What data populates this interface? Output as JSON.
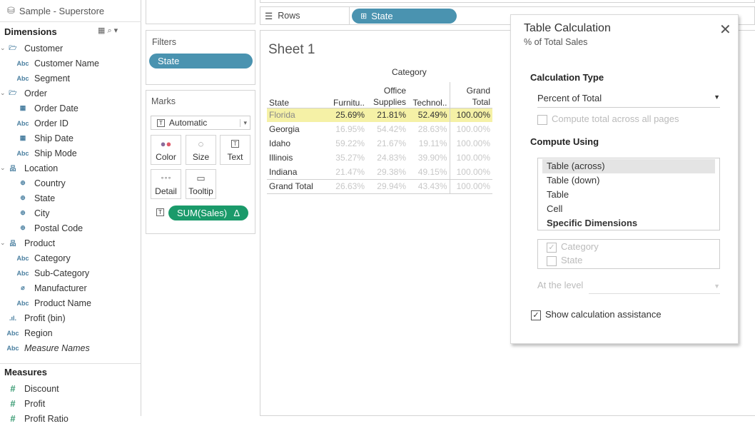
{
  "datasource": "Sample - Superstore",
  "dimensions": {
    "title": "Dimensions",
    "items": [
      {
        "label": "Customer",
        "icon": "folder-icon",
        "level": 0
      },
      {
        "label": "Customer Name",
        "icon": "Abc",
        "level": 1
      },
      {
        "label": "Segment",
        "icon": "Abc",
        "level": 1
      },
      {
        "label": "Order",
        "icon": "folder-icon",
        "level": 0
      },
      {
        "label": "Order Date",
        "icon": "calendar-icon",
        "level": 1
      },
      {
        "label": "Order ID",
        "icon": "Abc",
        "level": 1
      },
      {
        "label": "Ship Date",
        "icon": "calendar-icon",
        "level": 1
      },
      {
        "label": "Ship Mode",
        "icon": "Abc",
        "level": 1
      },
      {
        "label": "Location",
        "icon": "hierarchy-icon",
        "level": 0
      },
      {
        "label": "Country",
        "icon": "globe-icon",
        "level": 1
      },
      {
        "label": "State",
        "icon": "globe-icon",
        "level": 1
      },
      {
        "label": "City",
        "icon": "globe-icon",
        "level": 1
      },
      {
        "label": "Postal Code",
        "icon": "globe-icon",
        "level": 1
      },
      {
        "label": "Product",
        "icon": "hierarchy-icon",
        "level": 0
      },
      {
        "label": "Category",
        "icon": "Abc",
        "level": 1
      },
      {
        "label": "Sub-Category",
        "icon": "Abc",
        "level": 1
      },
      {
        "label": "Manufacturer",
        "icon": "paperclip-icon",
        "level": 1
      },
      {
        "label": "Product Name",
        "icon": "Abc",
        "level": 1
      },
      {
        "label": "Profit (bin)",
        "icon": "bin-icon",
        "level": 0
      },
      {
        "label": "Region",
        "icon": "Abc",
        "level": 0
      },
      {
        "label": "Measure Names",
        "icon": "Abc",
        "level": 0
      }
    ]
  },
  "measures": {
    "title": "Measures",
    "items": [
      "Discount",
      "Profit",
      "Profit Ratio"
    ]
  },
  "filters": {
    "title": "Filters",
    "pill": "State"
  },
  "marks": {
    "title": "Marks",
    "type": "Automatic",
    "buttons": [
      "Color",
      "Size",
      "Text",
      "Detail",
      "Tooltip"
    ],
    "pill": "SUM(Sales)",
    "pill_delta": "Δ"
  },
  "rows": {
    "label": "Rows",
    "pill": "State"
  },
  "sheet": {
    "title": "Sheet 1",
    "col_group": "Category",
    "headers": [
      "State",
      "Furnitu..",
      "Office Supplies",
      "Technol..",
      "Grand Total"
    ],
    "rows": [
      {
        "state": "Florida",
        "v": [
          "25.69%",
          "21.81%",
          "52.49%",
          "100.00%"
        ]
      },
      {
        "state": "Georgia",
        "v": [
          "16.95%",
          "54.42%",
          "28.63%",
          "100.00%"
        ]
      },
      {
        "state": "Idaho",
        "v": [
          "59.22%",
          "21.67%",
          "19.11%",
          "100.00%"
        ]
      },
      {
        "state": "Illinois",
        "v": [
          "35.27%",
          "24.83%",
          "39.90%",
          "100.00%"
        ]
      },
      {
        "state": "Indiana",
        "v": [
          "21.47%",
          "29.38%",
          "49.15%",
          "100.00%"
        ]
      }
    ],
    "total": {
      "state": "Grand Total",
      "v": [
        "26.63%",
        "29.94%",
        "43.43%",
        "100.00%"
      ]
    }
  },
  "dialog": {
    "title": "Table Calculation",
    "subtitle": "% of Total Sales",
    "calc_type_label": "Calculation Type",
    "calc_type": "Percent of Total",
    "compute_all_pages": "Compute total across all pages",
    "compute_using_label": "Compute Using",
    "compute_options": [
      "Table (across)",
      "Table (down)",
      "Table",
      "Cell",
      "Specific Dimensions"
    ],
    "dims": [
      "Category",
      "State"
    ],
    "at_level": "At the level",
    "show_assist": "Show calculation assistance"
  }
}
